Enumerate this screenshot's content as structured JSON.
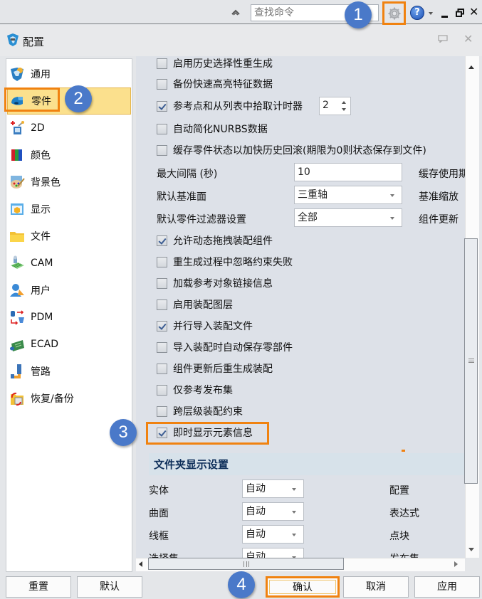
{
  "topbar": {
    "search_placeholder": "查找命令",
    "icons": [
      "collapse-ribbon-icon",
      "gear-icon",
      "help-icon",
      "minimize-icon",
      "restore-icon",
      "close-icon"
    ]
  },
  "dialog": {
    "title": "配置"
  },
  "sidebar": {
    "items": [
      {
        "label": "通用",
        "icon": "general-icon"
      },
      {
        "label": "零件",
        "icon": "part-icon",
        "selected": true
      },
      {
        "label": "2D",
        "icon": "2d-icon"
      },
      {
        "label": "颜色",
        "icon": "color-icon"
      },
      {
        "label": "背景色",
        "icon": "background-color-icon"
      },
      {
        "label": "显示",
        "icon": "display-icon"
      },
      {
        "label": "文件",
        "icon": "folder-icon"
      },
      {
        "label": "CAM",
        "icon": "cam-icon"
      },
      {
        "label": "用户",
        "icon": "user-icon"
      },
      {
        "label": "PDM",
        "icon": "pdm-icon"
      },
      {
        "label": "ECAD",
        "icon": "ecad-icon"
      },
      {
        "label": "管路",
        "icon": "piping-icon"
      },
      {
        "label": "恢复/备份",
        "icon": "restore-backup-icon"
      }
    ]
  },
  "main": {
    "checkboxes_top": [
      {
        "label": "启用历史选择性重生成",
        "checked": false
      },
      {
        "label": "备份快速高亮特征数据",
        "checked": false
      },
      {
        "label": "参考点和从列表中拾取计时器",
        "checked": true
      },
      {
        "label": "自动简化NURBS数据",
        "checked": false
      },
      {
        "label": "缓存零件状态以加快历史回滚(期限为0则状态保存到文件)",
        "checked": false
      }
    ],
    "pick_timer_value": "2",
    "fields": {
      "max_interval_label": "最大间隔 (秒)",
      "max_interval_value": "10",
      "default_datum_label": "默认基准面",
      "default_datum_value": "三重轴",
      "default_filter_label": "默认零件过滤器设置",
      "default_filter_value": "全部"
    },
    "right_labels": [
      "缓存使用期",
      "基准缩放",
      "组件更新"
    ],
    "checkboxes_bottom": [
      {
        "label": "允许动态拖拽装配组件",
        "checked": true
      },
      {
        "label": "重生成过程中忽略约束失败",
        "checked": false
      },
      {
        "label": "加载参考对象链接信息",
        "checked": false
      },
      {
        "label": "启用装配图层",
        "checked": false
      },
      {
        "label": "并行导入装配文件",
        "checked": true
      },
      {
        "label": "导入装配时自动保存零部件",
        "checked": false
      },
      {
        "label": "组件更新后重生成装配",
        "checked": false
      },
      {
        "label": "仅参考发布集",
        "checked": false
      },
      {
        "label": "跨层级装配约束",
        "checked": false
      },
      {
        "label": "即时显示元素信息",
        "checked": true
      }
    ],
    "folder_section": {
      "title": "文件夹显示设置",
      "rows": [
        {
          "label": "实体",
          "value": "自动",
          "right_label": "配置"
        },
        {
          "label": "曲面",
          "value": "自动",
          "right_label": "表达式"
        },
        {
          "label": "线框",
          "value": "自动",
          "right_label": "点块"
        },
        {
          "label": "选择集",
          "value": "自动",
          "right_label": "发布集"
        }
      ]
    }
  },
  "buttons": {
    "reset": "重置",
    "default": "默认",
    "ok": "确认",
    "cancel": "取消",
    "apply": "应用"
  },
  "callouts": [
    "1",
    "2",
    "3",
    "4"
  ],
  "colors": {
    "highlight_orange": "#f08210",
    "callout_blue": "#4a79c9",
    "selected_item_bg": "#fbe08d",
    "section_header_text": "#0e2f5a"
  }
}
